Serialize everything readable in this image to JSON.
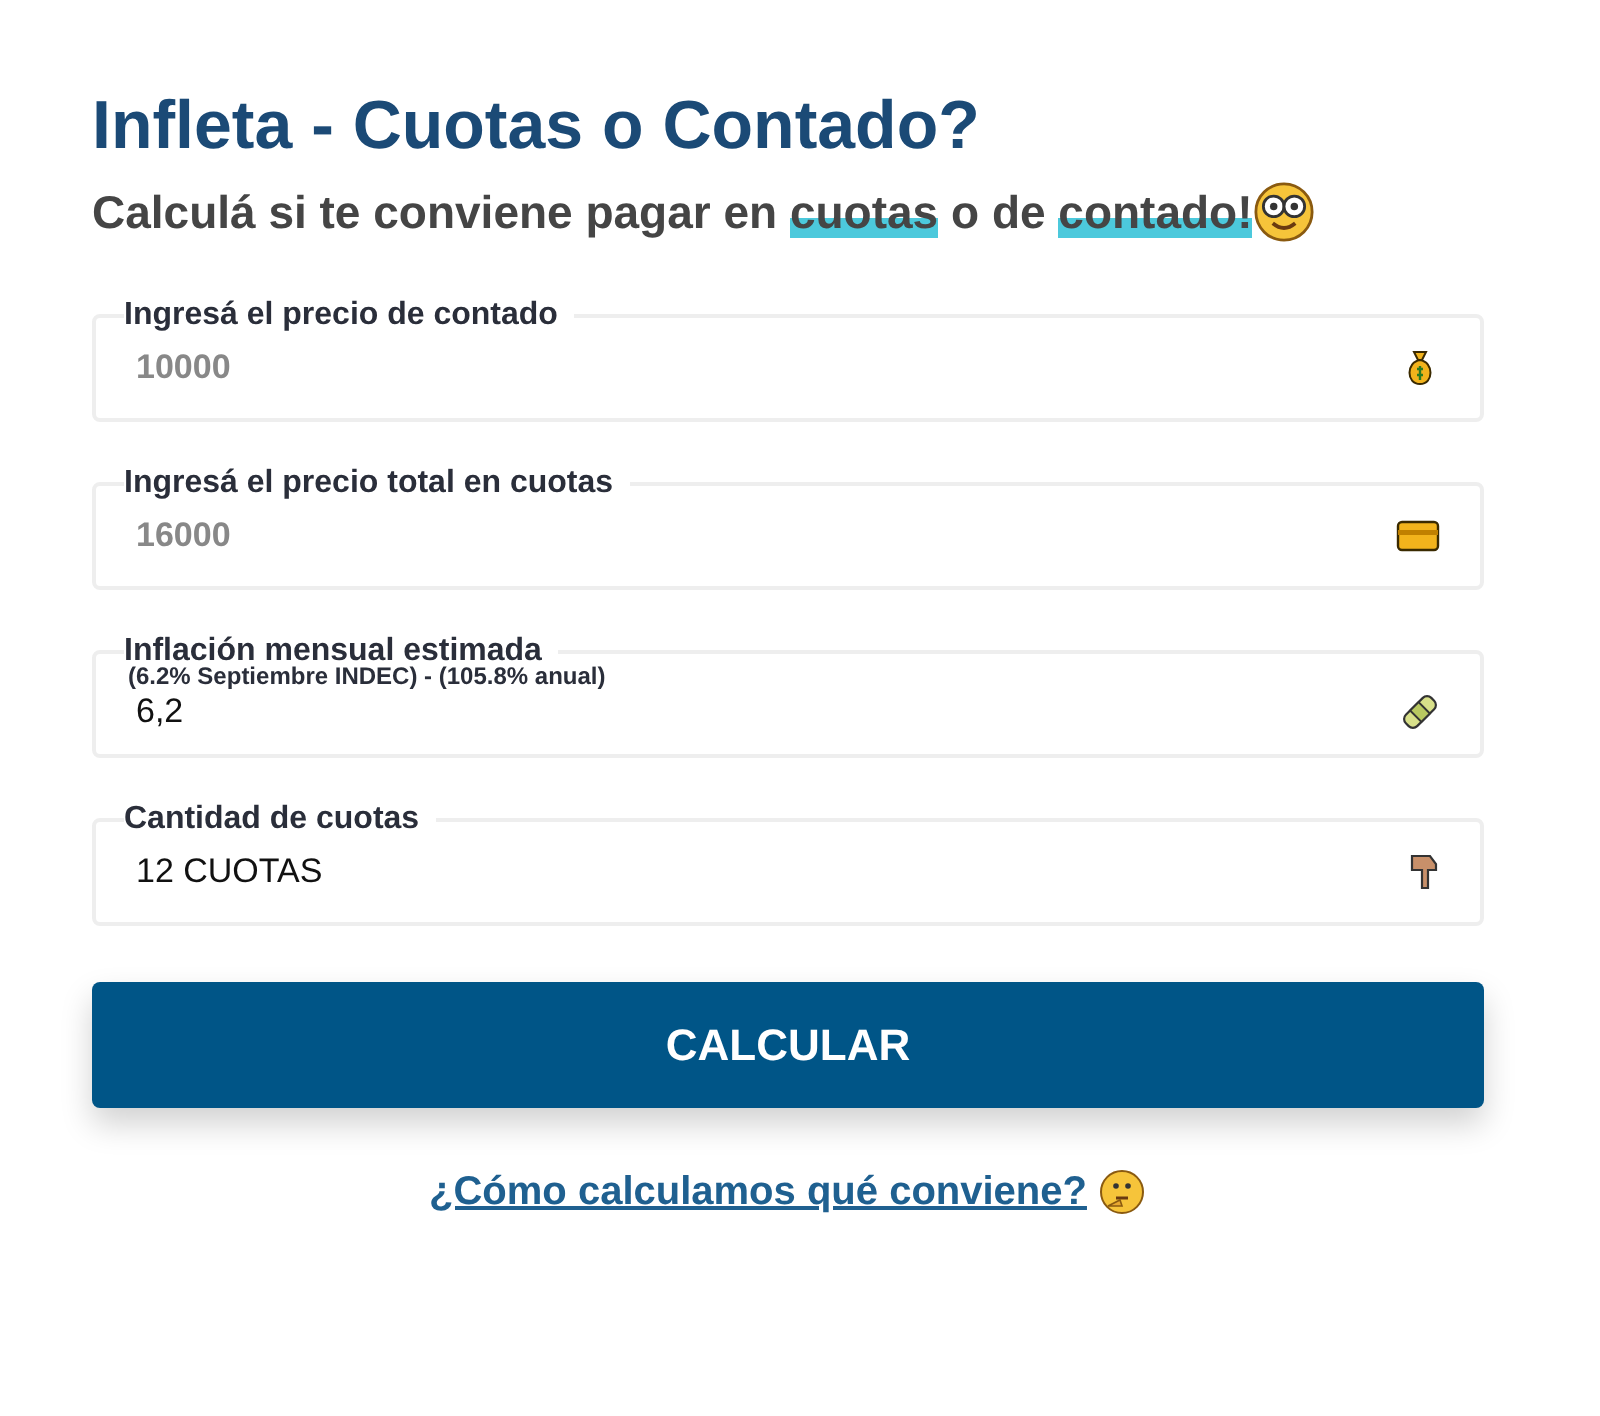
{
  "title": "Infleta - Cuotas o Contado?",
  "subtitle": [
    {
      "text": "Calculá si te conviene pagar en ",
      "highlight": false
    },
    {
      "text": "cuotas",
      "highlight": true
    },
    {
      "text": " o de ",
      "highlight": false
    },
    {
      "text": "contado!",
      "highlight": true
    }
  ],
  "fields": [
    {
      "label": "Ingresá el precio de contado",
      "placeholder": "10000"
    },
    {
      "label": "Ingresá el precio total en cuotas",
      "placeholder": "16000"
    },
    {
      "label": "Inflación mensual estimada",
      "note": "(6.2% Septiembre INDEC) - (105.8% anual)",
      "value": "6,2"
    },
    {
      "label": "Cantidad de cuotas",
      "value": "12 CUOTAS"
    }
  ],
  "button": "CALCULAR",
  "link": "¿Cómo calculamos qué conviene?"
}
